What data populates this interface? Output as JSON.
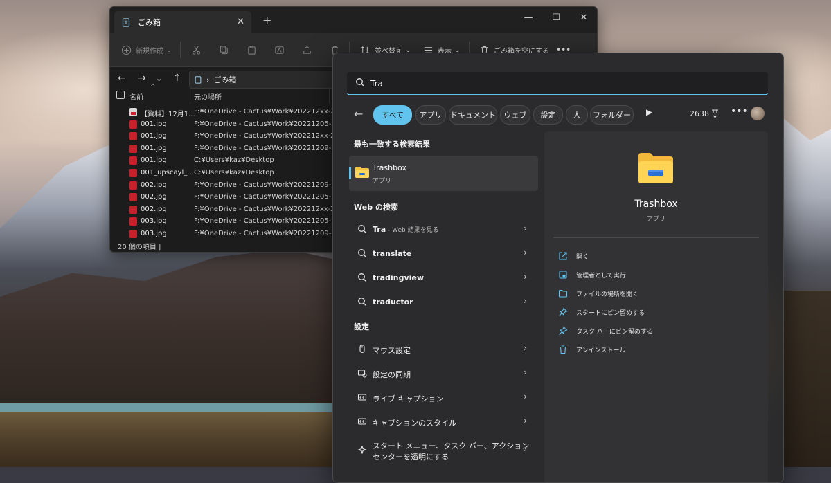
{
  "explorer": {
    "tab_title": "ごみ箱",
    "tab_close": "✕",
    "new_tab": "+",
    "window_controls": [
      "—",
      "☐",
      "✕"
    ],
    "toolbar": {
      "new_label": "新規作成",
      "sort_label": "並べ替え",
      "view_label": "表示",
      "empty_label": "ごみ箱を空にする",
      "more": "•••"
    },
    "address": {
      "crumb": "ごみ箱",
      "separator": "›"
    },
    "columns": {
      "name": "名前",
      "location": "元の場所",
      "sort_indicator": "^"
    },
    "files": [
      {
        "name": "【資料】12月1...",
        "location": "F:¥OneDrive - Cactus¥Work¥202212xx-Z...",
        "icon": "pdf"
      },
      {
        "name": "001.jpg",
        "location": "F:¥OneDrive - Cactus¥Work¥20221205-...",
        "icon": "jpg"
      },
      {
        "name": "001.jpg",
        "location": "F:¥OneDrive - Cactus¥Work¥202212xx-Z...",
        "icon": "jpg"
      },
      {
        "name": "001.jpg",
        "location": "F:¥OneDrive - Cactus¥Work¥20221209-...",
        "icon": "jpg"
      },
      {
        "name": "001.jpg",
        "location": "C:¥Users¥kaz¥Desktop",
        "icon": "jpg"
      },
      {
        "name": "001_upscayl_...",
        "location": "C:¥Users¥kaz¥Desktop",
        "icon": "jpg"
      },
      {
        "name": "002.jpg",
        "location": "F:¥OneDrive - Cactus¥Work¥20221209-...",
        "icon": "jpg"
      },
      {
        "name": "002.jpg",
        "location": "F:¥OneDrive - Cactus¥Work¥20221205-...",
        "icon": "jpg"
      },
      {
        "name": "002.jpg",
        "location": "F:¥OneDrive - Cactus¥Work¥202212xx-Z...",
        "icon": "jpg"
      },
      {
        "name": "003.jpg",
        "location": "F:¥OneDrive - Cactus¥Work¥20221205-...",
        "icon": "jpg"
      },
      {
        "name": "003.jpg",
        "location": "F:¥OneDrive - Cactus¥Work¥20221209-...",
        "icon": "jpg"
      }
    ],
    "status": "20 個の項目 |"
  },
  "search": {
    "query": "Tra",
    "filters": [
      "すべて",
      "アプリ",
      "ドキュメント",
      "ウェブ",
      "設定",
      "人",
      "フォルダー"
    ],
    "active_filter": "すべて",
    "count": "2638",
    "more": "•••",
    "best_match_title": "最も一致する検索結果",
    "best_match": {
      "name": "Trashbox",
      "type": "アプリ"
    },
    "web_title": "Web の検索",
    "web_results": [
      {
        "text": "Tra",
        "suffix": " - Web 結果を見る"
      },
      {
        "text": "translate"
      },
      {
        "text": "tradingview"
      },
      {
        "text": "traductor"
      }
    ],
    "settings_title": "設定",
    "settings_results": [
      {
        "text": "マウス設定",
        "icon": "mouse-icon"
      },
      {
        "text": "設定の同期",
        "icon": "sync-icon"
      },
      {
        "text": "ライブ キャプション",
        "icon": "cc-icon"
      },
      {
        "text": "キャプションのスタイル",
        "icon": "cc-icon"
      },
      {
        "line1": "スタート メニュー、タスク バー、アクション",
        "line2": "センターを透明にする",
        "icon": "transparency-icon"
      }
    ],
    "detail": {
      "name": "Trashbox",
      "type": "アプリ",
      "actions": [
        "開く",
        "管理者として実行",
        "ファイルの場所を開く",
        "スタートにピン留めする",
        "タスク バーにピン留めする",
        "アンインストール"
      ]
    }
  },
  "colors": {
    "accent": "#60c4ee",
    "panel": "#2b2b2d",
    "explorer_bg": "#1c1c1c"
  }
}
